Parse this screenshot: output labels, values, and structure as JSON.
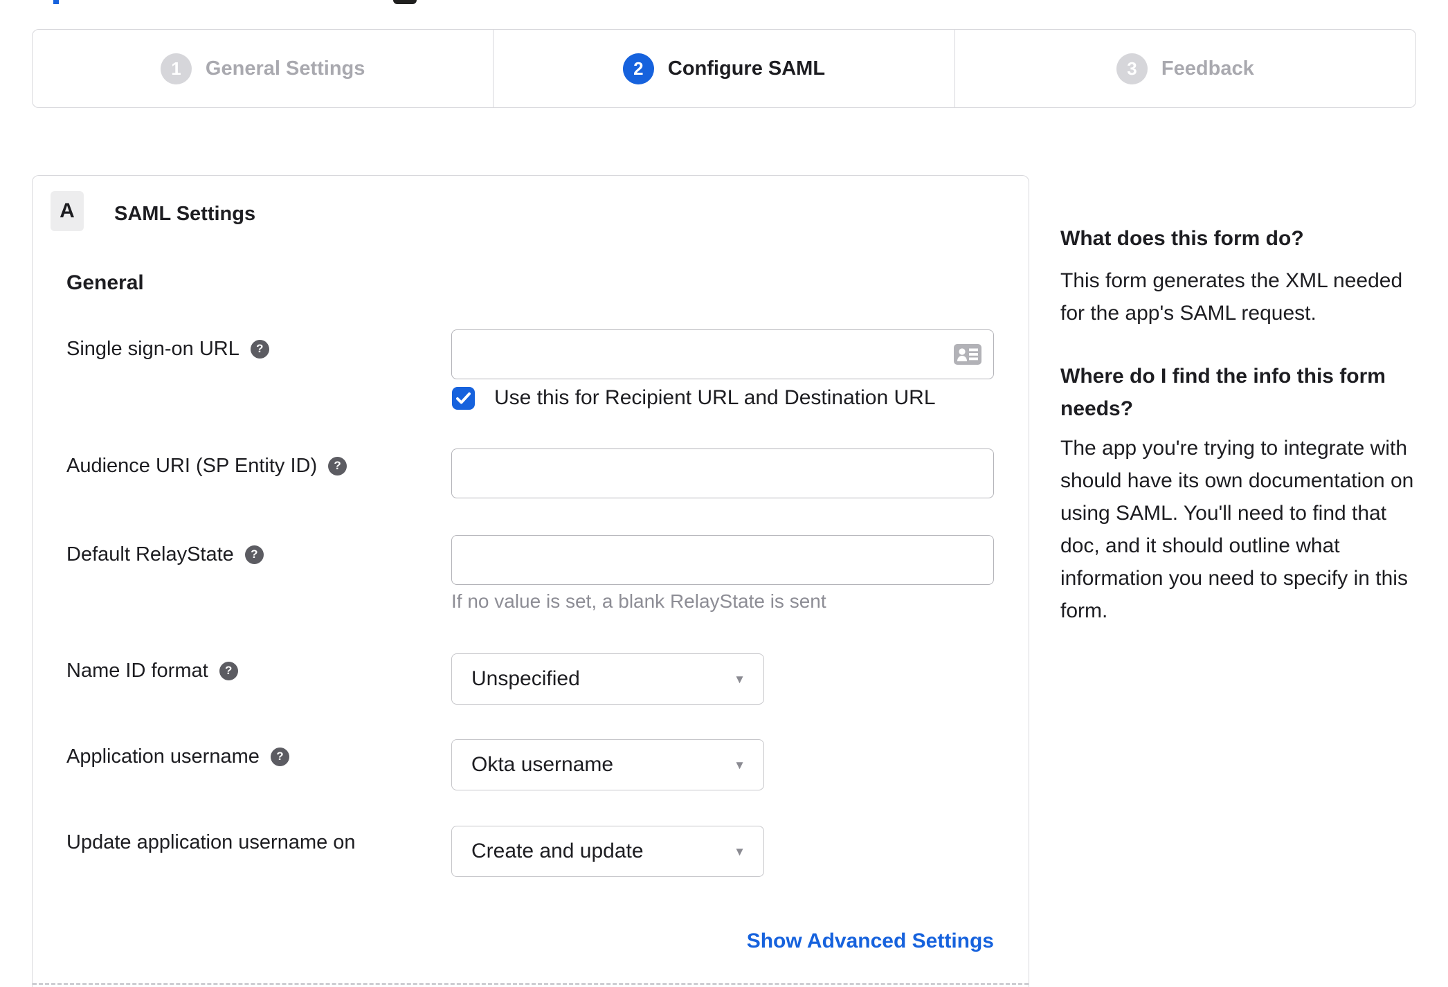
{
  "colors": {
    "accent": "#1662dd",
    "inactive_step": "#d6d6da"
  },
  "stepper": {
    "steps": [
      {
        "number": "1",
        "label": "General Settings",
        "state": "inactive"
      },
      {
        "number": "2",
        "label": "Configure SAML",
        "state": "active"
      },
      {
        "number": "3",
        "label": "Feedback",
        "state": "inactive"
      }
    ]
  },
  "panel": {
    "section_letter": "A",
    "section_title": "SAML Settings",
    "group_title": "General",
    "fields": {
      "sso": {
        "label": "Single sign-on URL",
        "value": "",
        "checkbox_label": "Use this for Recipient URL and Destination URL",
        "checkbox_checked": true
      },
      "audience": {
        "label": "Audience URI (SP Entity ID)",
        "value": ""
      },
      "relay": {
        "label": "Default RelayState",
        "value": "",
        "helper": "If no value is set, a blank RelayState is sent"
      },
      "name_id": {
        "label": "Name ID format",
        "value": "Unspecified"
      },
      "app_username": {
        "label": "Application username",
        "value": "Okta username"
      },
      "update_username": {
        "label": "Update application username on",
        "value": "Create and update"
      }
    },
    "advanced_link": "Show Advanced Settings",
    "help_glyph": "?"
  },
  "sidebar": {
    "q1": "What does this form do?",
    "a1_lines": [
      "This form generates the XML needed",
      "for the app's SAML request."
    ],
    "q2_lines": [
      "Where do I find the info this form",
      "needs?"
    ],
    "a2_lines": [
      "The app you're trying to integrate with",
      "should have its own documentation on",
      "using SAML. You'll need to find that",
      "doc, and it should outline what",
      "information you need to specify in this",
      "form."
    ]
  }
}
